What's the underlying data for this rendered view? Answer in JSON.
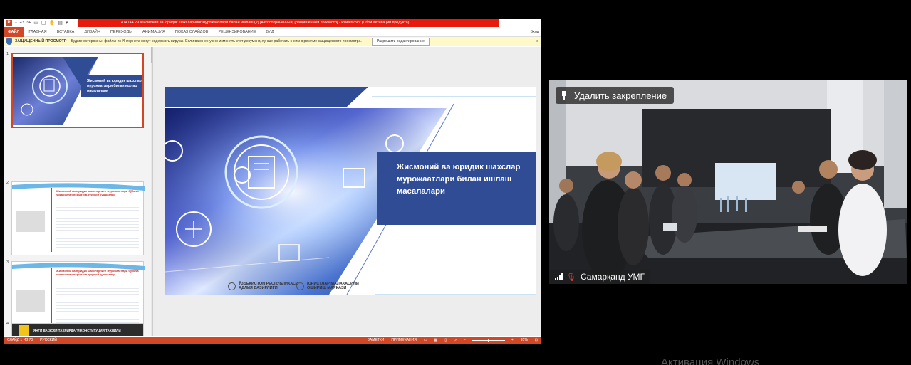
{
  "ppt": {
    "window_title": "474744.29.Жисмоний ва юридик шахсларнинг мурожаатлари билан ишлаш (2) [Автосохраненный] [Защищенный просмотр] - PowerPoint (Сбой активации продукта)",
    "app_icon": "P",
    "qat_icons": [
      "save-icon",
      "undo-icon",
      "redo-icon",
      "open-icon",
      "new-icon",
      "touch-icon",
      "print-icon",
      "more-icon"
    ],
    "ribbon_tabs": [
      "ФАЙЛ",
      "ГЛАВНАЯ",
      "ВСТАВКА",
      "ДИЗАЙН",
      "ПЕРЕХОДЫ",
      "АНИМАЦИЯ",
      "ПОКАЗ СЛАЙДОВ",
      "РЕЦЕНЗИРОВАНИЕ",
      "ВИД"
    ],
    "signin": "Вход",
    "protected_bar": {
      "title": "ЗАЩИЩЕННЫЙ ПРОСМОТР",
      "message": "Будьте осторожны: файлы из Интернета могут содержать вирусы. Если вам не нужно изменять этот документ, лучше работать с ним в режиме защищенного просмотра.",
      "button": "Разрешить редактирование",
      "close": "×"
    },
    "thumbnails": [
      {
        "num": "1",
        "title": "Жисмоний ва юридик шахслар мурожаатлари билан ишлаш масалалари"
      },
      {
        "num": "2",
        "heading": "Жисмоний ва юридик шахсларнинг мурожаатлари бўйича чиқарилган норматив-ҳуқуқий ҳужжатлар"
      },
      {
        "num": "3",
        "heading": "Жисмоний ва юридик шахсларнинг мурожаатлари бўйича чиқарилган норматив-ҳуқуқий ҳужжатлар"
      },
      {
        "num": "4",
        "heading": "ЯНГИ ВА ЭСКИ ТАҲРИРДАГИ КОНСТИТУЦИЯ ТАҲЛИЛИ"
      }
    ],
    "slide": {
      "title_lines": [
        "Жисмоний ва юридик шахслар",
        "мурожаатлари билан ишлаш",
        "масалалари"
      ],
      "logo_left": [
        "ЎЗБЕКИСТОН РЕСПУБЛИКАСИ",
        "АДЛИЯ ВАЗИРЛИГИ"
      ],
      "logo_right": [
        "ЮРИСТЛАР МАЛАКАСИНИ",
        "ОШИРИШ МАРКАЗИ"
      ]
    },
    "status": {
      "slide": "СЛАЙД 1 ИЗ 70",
      "language": "РУССКИЙ",
      "notes": "ЗАМЕТКИ",
      "comments": "ПРИМЕЧАНИЯ",
      "zoom": "95%"
    },
    "colors": {
      "accent": "#d24726",
      "title_red": "#e8190d",
      "slide_blue": "#2f4c95"
    }
  },
  "video": {
    "unpin_label": "Удалить закрепление",
    "participant": "Самарқанд УМГ"
  },
  "activation_text": "Активация Windows"
}
